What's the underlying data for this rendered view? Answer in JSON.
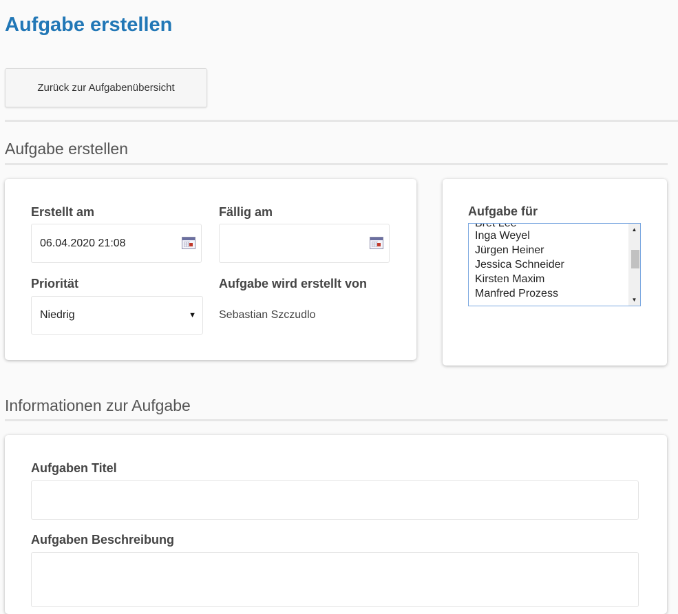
{
  "header": {
    "title": "Aufgabe erstellen",
    "back_button_label": "Zurück zur Aufgabenübersicht"
  },
  "section_create": {
    "heading": "Aufgabe erstellen",
    "created_at": {
      "label": "Erstellt am",
      "value": "06.04.2020 21:08"
    },
    "due_at": {
      "label": "Fällig am",
      "value": ""
    },
    "priority": {
      "label": "Priorität",
      "selected": "Niedrig"
    },
    "created_by": {
      "label": "Aufgabe wird erstellt von",
      "value": "Sebastian Szczudlo"
    },
    "assignee": {
      "label": "Aufgabe für",
      "options": [
        "Bret Lee",
        "Inga Weyel",
        "Jürgen Heiner",
        "Jessica Schneider",
        "Kirsten Maxim",
        "Manfred Prozess"
      ]
    }
  },
  "section_info": {
    "heading": "Informationen zur Aufgabe",
    "title_field": {
      "label": "Aufgaben Titel",
      "value": ""
    },
    "description_field": {
      "label": "Aufgaben Beschreibung",
      "value": ""
    }
  },
  "icons": {
    "calendar": "calendar-icon",
    "select_arrow": "▼",
    "scroll_up": "▲",
    "scroll_down": "▼"
  },
  "colors": {
    "title": "#2177b6",
    "listbox_border": "#7aa7e0"
  }
}
